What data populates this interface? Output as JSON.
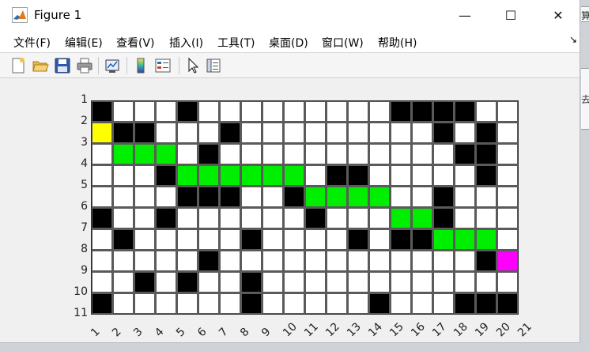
{
  "window": {
    "title": "Figure 1",
    "minimize_glyph": "—",
    "maximize_glyph": "☐",
    "close_glyph": "✕"
  },
  "menu": {
    "items": [
      "文件(F)",
      "编辑(E)",
      "查看(V)",
      "插入(I)",
      "工具(T)",
      "桌面(D)",
      "窗口(W)",
      "帮助(H)"
    ],
    "overflow_glyph": "↘"
  },
  "toolbar": {
    "icons": [
      "new-figure-icon",
      "open-file-icon",
      "save-icon",
      "print-icon",
      "link-plot-icon",
      "colorbar-icon",
      "legend-icon",
      "pointer-icon",
      "property-inspector-icon"
    ]
  },
  "plot": {
    "rows": 10,
    "cols": 20,
    "x_ticks": [
      "1",
      "2",
      "3",
      "4",
      "5",
      "6",
      "7",
      "8",
      "9",
      "10",
      "11",
      "12",
      "13",
      "14",
      "15",
      "16",
      "17",
      "18",
      "19",
      "20",
      "21"
    ],
    "y_ticks": [
      "1",
      "2",
      "3",
      "4",
      "5",
      "6",
      "7",
      "8",
      "9",
      "10",
      "11"
    ],
    "colors": {
      "free": "#ffffff",
      "obstacle": "#000000",
      "path": "#00ee00",
      "start": "#ffff00",
      "goal": "#ff00ff",
      "gridline": "#5a5a5a"
    },
    "grid": [
      "BWWWBWWWWWWWWWBBBBWW",
      "SBBWWWBWWWWWWWWWBWBW",
      "WPPPWBWWWWWWWWWWWBBW",
      "WWWBPPPPPPWBBWWWWWBW",
      "WWWWBBBWWBPPPPWWBWWW",
      "BWWBWWWWWWBWWWPPBWWW",
      "WBWWWWWBWWWWBWBBPPPW",
      "WWWWWBWWWWWWWWWWWWBG",
      "WWBWBWWBWWWWWWWWWWWW",
      "BWWWWWWBWWWWWBWWWBBB"
    ]
  },
  "edge_panel": {
    "text_top": "算r",
    "text_mid": "去"
  }
}
